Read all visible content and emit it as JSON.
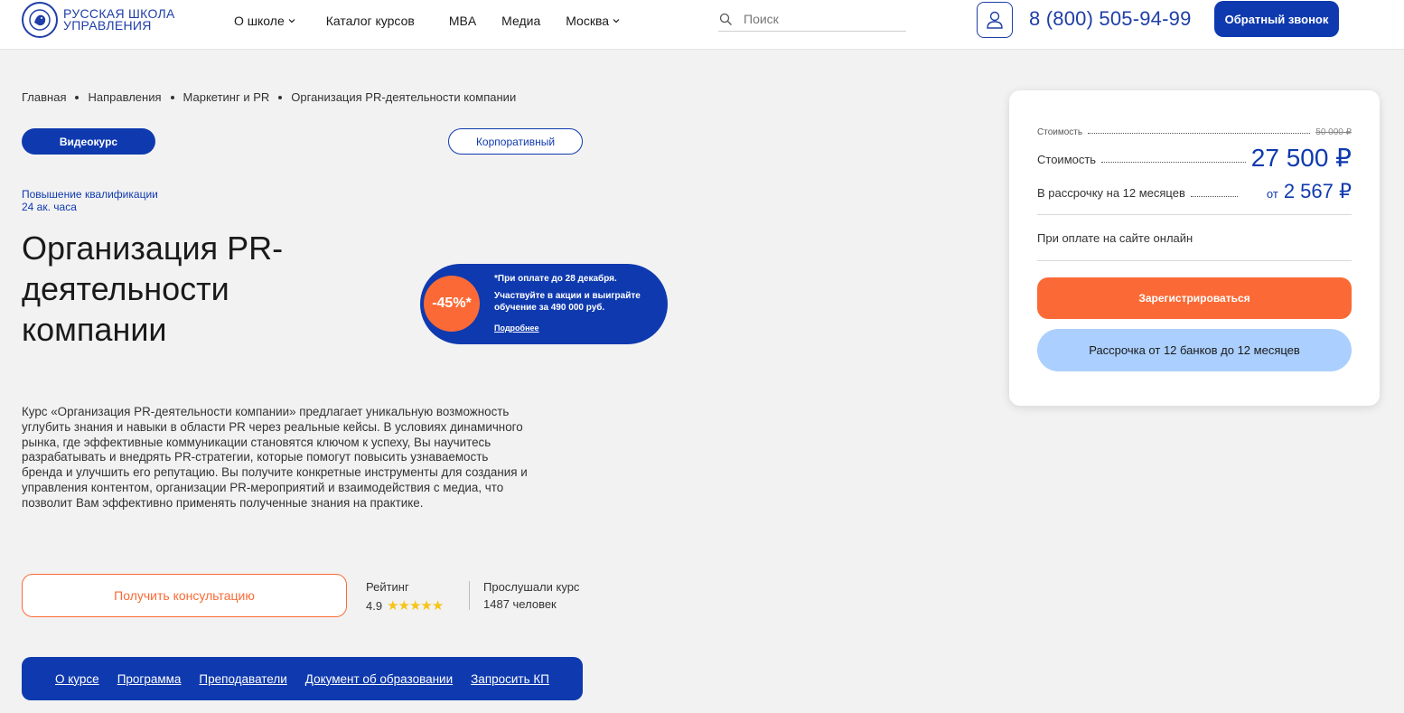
{
  "header": {
    "logo_text_line1": "Русская школа",
    "logo_text_line2": "управления",
    "nav": [
      {
        "label": "О школе",
        "has_dropdown": true
      },
      {
        "label": "Каталог курсов",
        "has_dropdown": false
      },
      {
        "label": "MBA",
        "has_dropdown": false
      },
      {
        "label": "Медиа",
        "has_dropdown": false
      },
      {
        "label": "Москва",
        "has_dropdown": true
      }
    ],
    "search_placeholder": "Поиск",
    "phone": "8 (800) 505-94-99",
    "callback_label": "Обратный звонок"
  },
  "breadcrumb": [
    "Главная",
    "Направления",
    "Маркетинг и PR",
    "Организация PR-деятельности компании"
  ],
  "tags": {
    "video": "Видеокурс",
    "corporate": "Корпоративный"
  },
  "qualification": {
    "type": "Повышение квалификации",
    "hours": "24 ак. часа"
  },
  "course_title": "Организация PR-деятельности компании",
  "description": "Курс «Организация PR-деятельности компании» предлагает уникальную возможность углубить знания и навыки в области PR через реальные кейсы. В условиях динамичного рынка, где эффективные коммуникации становятся ключом к успеху, Вы научитесь разрабатывать и внедрять PR-стратегии, которые помогут повысить узнаваемость бренда и улучшить его репутацию. Вы получите конкретные инструменты для создания и управления контентом, организации PR-мероприятий и взаимодействия с медиа, что позволит Вам эффективно применять полученные знания на практике.",
  "promo": {
    "badge": "-45%*",
    "line1": "*При оплате до 28 декабря.",
    "line2": "Участвуйте в акции и выиграйте обучение за 490 000 руб.",
    "link": "Подробнее"
  },
  "consult_label": "Получить консультацию",
  "rating": {
    "label": "Рейтинг",
    "value": "4.9",
    "stars": 5
  },
  "listened": {
    "label": "Прослушали курс",
    "count": "1487 человек"
  },
  "course_nav": [
    "О курсе",
    "Программа",
    "Преподаватели",
    "Документ об образовании",
    "Запросить КП"
  ],
  "price": {
    "old_label": "Стоимость",
    "old_value": "50 000 ₽",
    "main_label": "Стоимость",
    "main_value": "27 500 ₽",
    "installment_label": "В рассрочку на 12 месяцев",
    "installment_from": "от",
    "installment_value": "2 567 ₽",
    "pay_online": "При оплате на сайте онлайн",
    "register_label": "Зарегистрироваться",
    "installment_btn_label": "Рассрочка от 12 банков до 12 месяцев"
  },
  "colors": {
    "brand_blue": "#0f3aaf",
    "accent_orange": "#fb6a36",
    "light_blue": "#abcffe",
    "star": "#f5c518"
  }
}
